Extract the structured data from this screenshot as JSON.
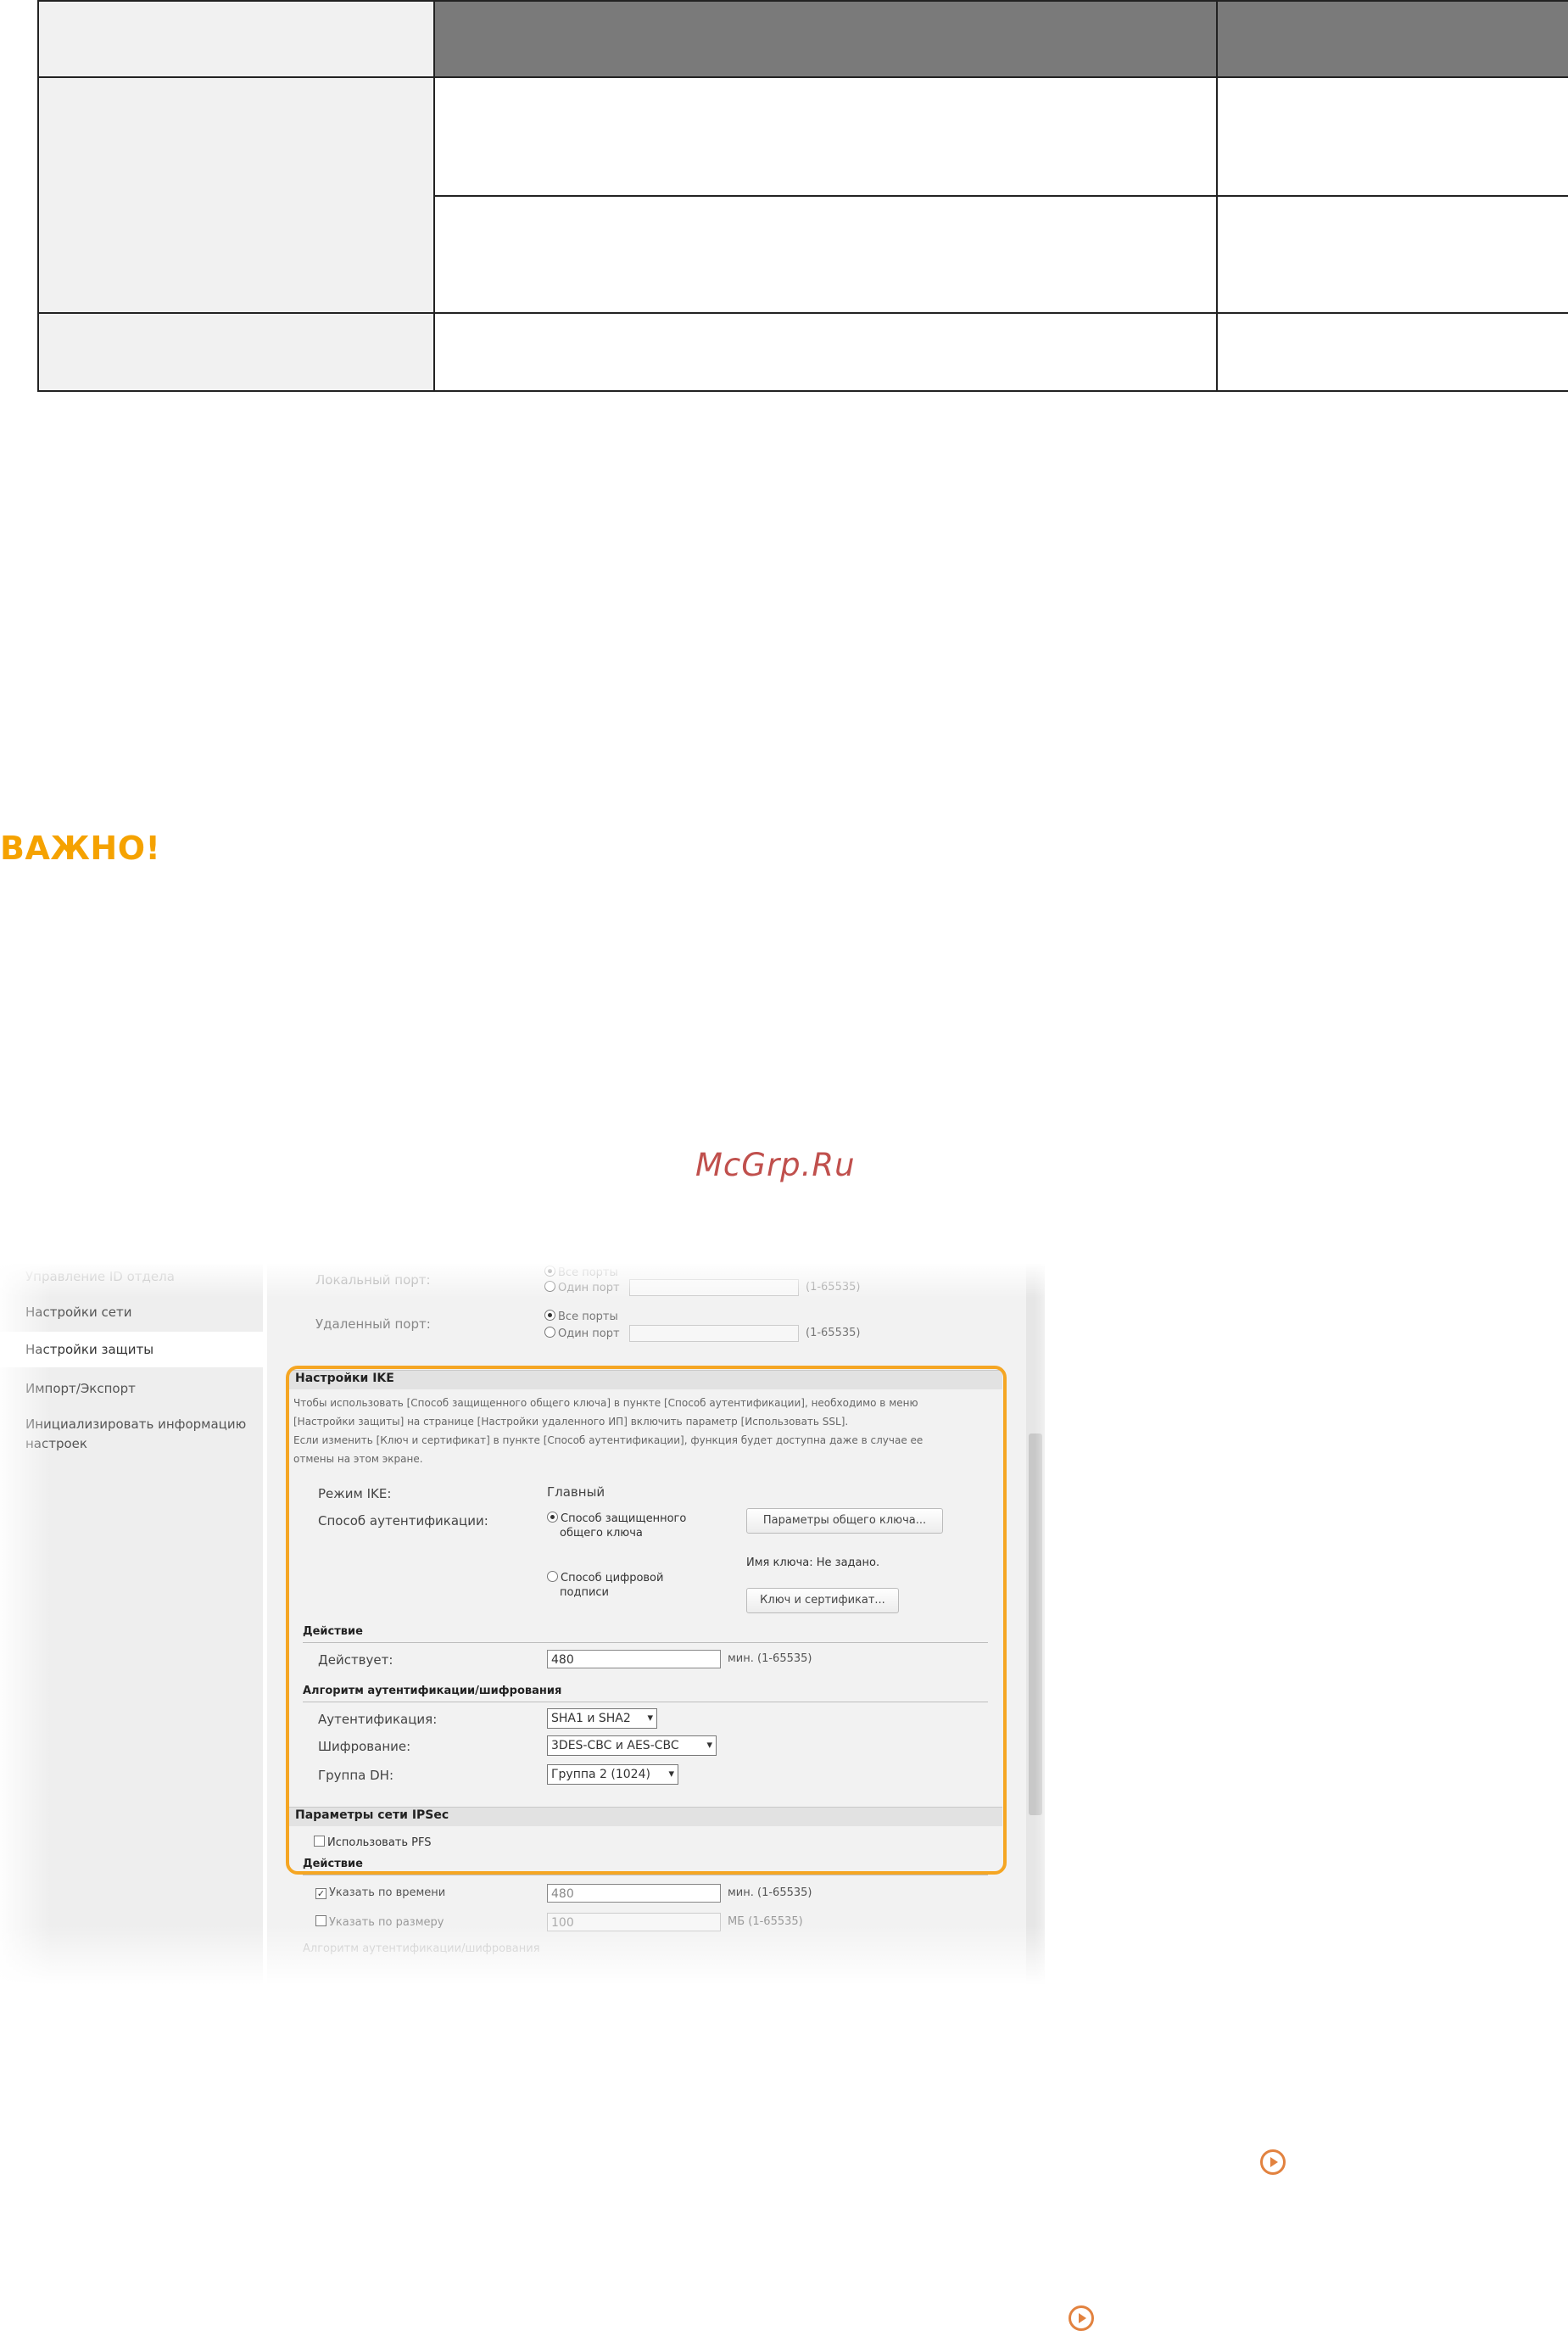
{
  "important_heading": "ВАЖНО!",
  "watermark": "McGrp.Ru",
  "screenshot": {
    "sidebar": {
      "items": [
        "Управление ID отдела",
        "Настройки сети",
        "Настройки защиты",
        "Импорт/Экспорт",
        "Инициализировать информацию настроек"
      ],
      "active_index": 2
    },
    "top_rows": {
      "local_port_label": "Локальный порт:",
      "remote_port_label": "Удаленный порт:",
      "all_ports": "Все порты",
      "one_port": "Один порт",
      "port_range": "(1-65535)"
    },
    "ike": {
      "title": "Настройки IKE",
      "desc_line1": "Чтобы использовать [Способ защищенного общего ключа] в пункте [Способ аутентификации], необходимо в меню",
      "desc_line2": "[Настройки защиты] на странице [Настройки удаленного ИП] включить параметр [Использовать SSL].",
      "desc_line3": "Если изменить [Ключ и сертификат] в пункте [Способ аутентификации], функция будет доступна даже в случае ее",
      "desc_line4": "отмены на этом экране.",
      "mode_label": "Режим IKE:",
      "mode_value": "Главный",
      "auth_method_label": "Способ аутентификации:",
      "psk_option_line1": "Способ защищенного",
      "psk_option_line2": "общего ключа",
      "psk_button": "Параметры общего ключа...",
      "signature_option_line1": "Способ цифровой",
      "signature_option_line2": "подписи",
      "key_name_text": "Имя ключа: Не задано.",
      "key_cert_button": "Ключ и сертификат...",
      "validity_section": "Действие",
      "validity_label": "Действует:",
      "validity_value": "480",
      "validity_unit": "мин. (1-65535)",
      "algo_section": "Алгоритм аутентификации/шифрования",
      "auth_label": "Аутентификация:",
      "auth_value": "SHA1 и SHA2",
      "enc_label": "Шифрование:",
      "enc_value": "3DES-CBC и AES-CBC",
      "dh_label": "Группа DH:",
      "dh_value": "Группа 2 (1024)"
    },
    "ipsec": {
      "title": "Параметры сети IPSec",
      "pfs_label": "Использовать PFS",
      "validity_section": "Действие",
      "by_time_label": "Указать по времени",
      "by_time_value": "480",
      "by_time_unit": "мин. (1-65535)",
      "by_size_label": "Указать по размеру",
      "by_size_value": "100",
      "by_size_unit": "МБ (1-65535)",
      "algo_section": "Алгоритм аутентификации/шифрования"
    }
  },
  "colors": {
    "important": "#f5a200",
    "highlight": "#f5a623",
    "link_icon": "#e2823f",
    "watermark": "#c0504d"
  }
}
